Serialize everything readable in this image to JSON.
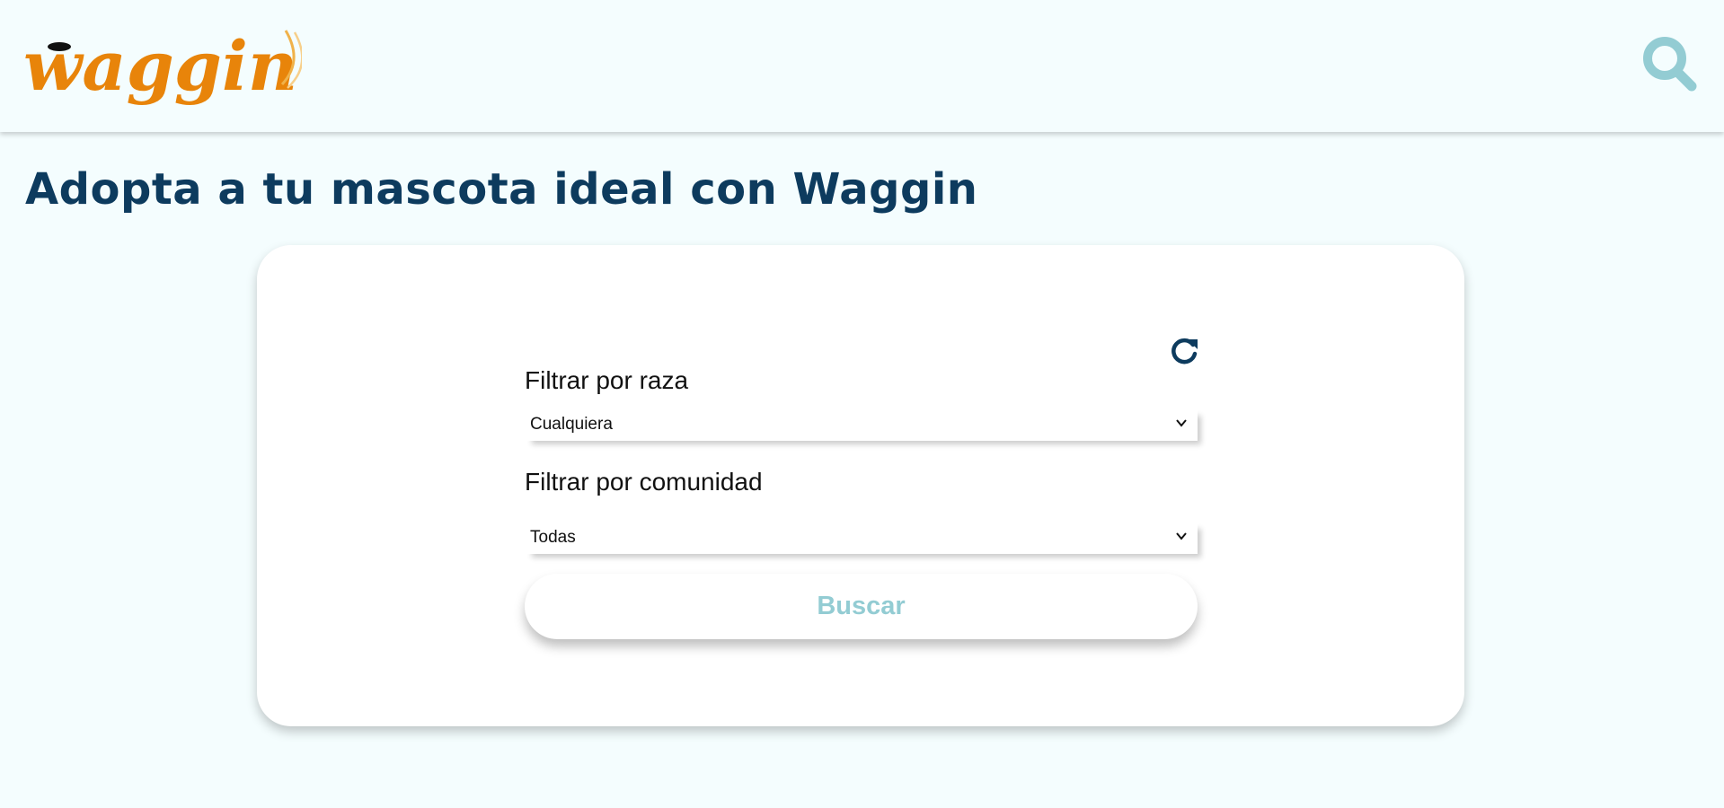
{
  "header": {
    "logo_text": "waggin",
    "search_icon": "search-icon"
  },
  "page": {
    "title": "Adopta a tu mascota ideal con Waggin"
  },
  "filters": {
    "refresh_icon": "refresh-icon",
    "breed_label": "Filtrar por raza",
    "breed_value": "Cualquiera",
    "community_label": "Filtrar por comunidad",
    "community_value": "Todas",
    "search_button": "Buscar"
  },
  "colors": {
    "brand": "#e8840a",
    "title": "#0d3b5e",
    "accent": "#93ccd3",
    "background": "#f4fdfe"
  }
}
